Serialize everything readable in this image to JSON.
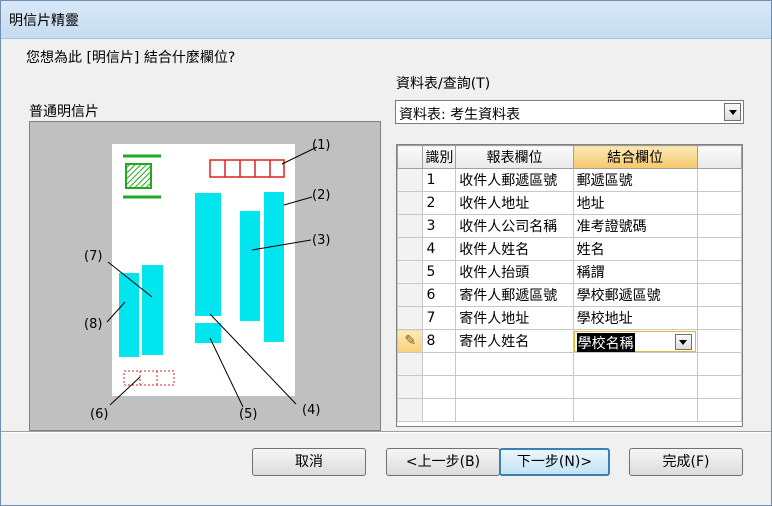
{
  "window": {
    "title": "明信片精靈"
  },
  "question": "您想為此 [明信片] 結合什麼欄位?",
  "preview": {
    "label": "普通明信片",
    "callouts": [
      "(1)",
      "(2)",
      "(3)",
      "(4)",
      "(5)",
      "(6)",
      "(7)",
      "(8)"
    ]
  },
  "table_query": {
    "label": "資料表/查詢(T)",
    "value": "資料表: 考生資料表"
  },
  "grid": {
    "headers": [
      "識別",
      "報表欄位",
      "結合欄位"
    ],
    "rows": [
      {
        "id": "1",
        "report": "收件人郵遞區號",
        "bound": "郵遞區號"
      },
      {
        "id": "2",
        "report": "收件人地址",
        "bound": "地址"
      },
      {
        "id": "3",
        "report": "收件人公司名稱",
        "bound": "准考證號碼"
      },
      {
        "id": "4",
        "report": "收件人姓名",
        "bound": "姓名"
      },
      {
        "id": "5",
        "report": "收件人抬頭",
        "bound": "稱謂"
      },
      {
        "id": "6",
        "report": "寄件人郵遞區號",
        "bound": "學校郵遞區號"
      },
      {
        "id": "7",
        "report": "寄件人地址",
        "bound": "學校地址"
      },
      {
        "id": "8",
        "report": "寄件人姓名",
        "bound": "學校名稱"
      }
    ],
    "current_row_indicator": "pencil-icon"
  },
  "buttons": {
    "cancel": "取消",
    "back": "<上一步(B)",
    "next": "下一步(N)>",
    "finish": "完成(F)"
  },
  "colors": {
    "field": "#00e5ee",
    "stamp": "#e02020",
    "logo": "#1faa1f"
  }
}
